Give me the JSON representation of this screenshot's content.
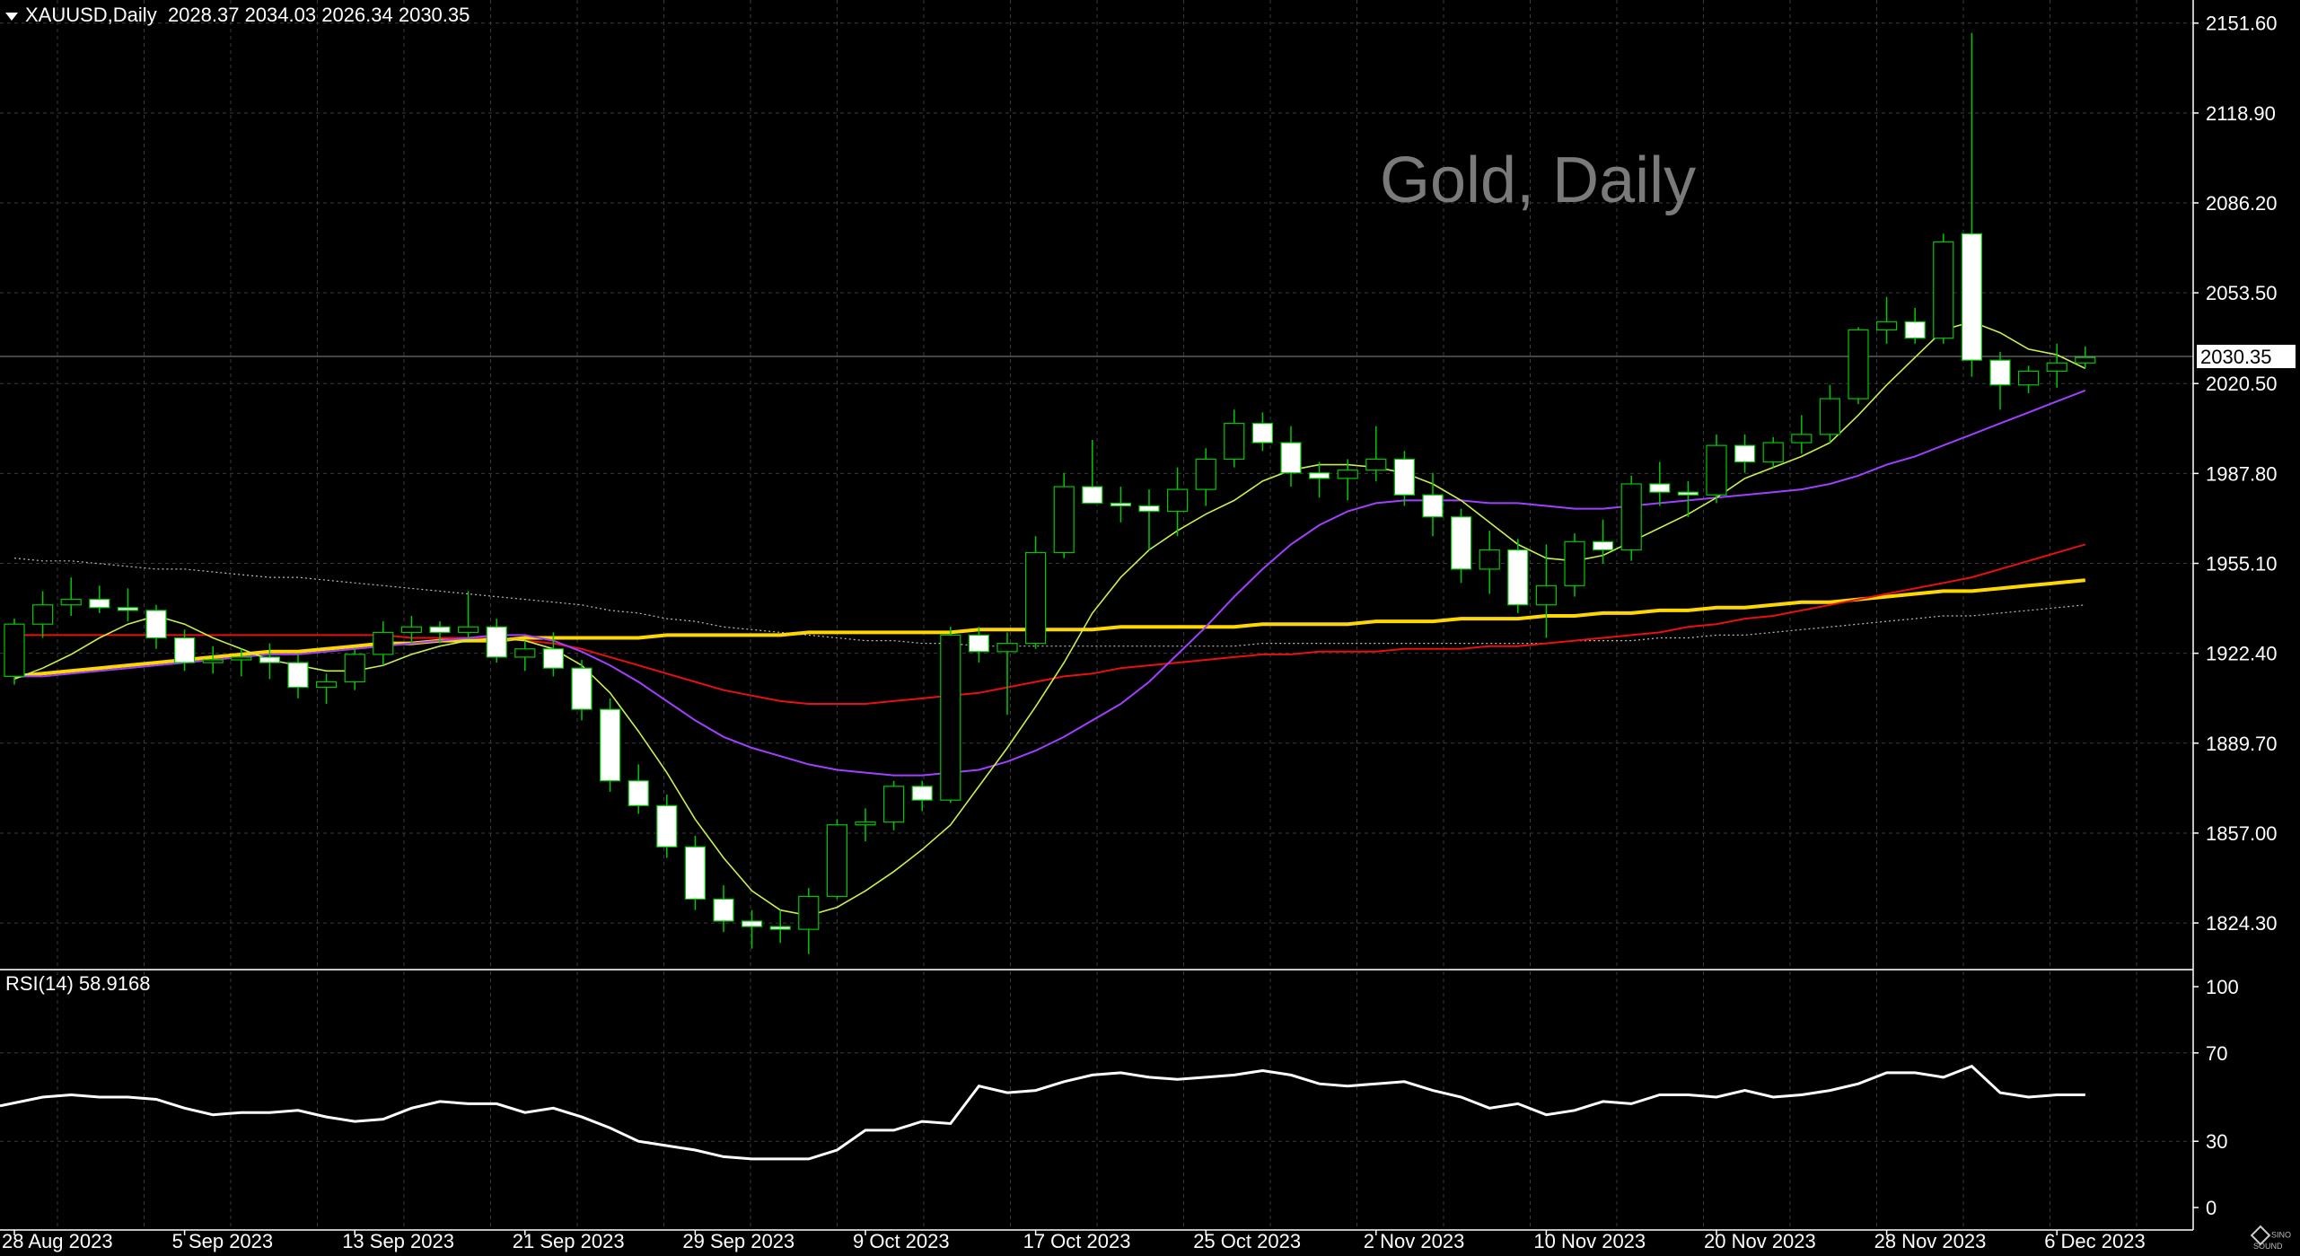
{
  "header": {
    "symbol": "XAUUSD,Daily",
    "ohlc": "2028.37 2034.03 2026.34 2030.35"
  },
  "watermark": "Gold, Daily",
  "rsi_label": "RSI(14) 58.9168",
  "logo_text": "SINO SOUND",
  "colors": {
    "background": "#000000",
    "grid": "#3a3a3a",
    "candle_up": "#000000",
    "candle_down": "#ffffff",
    "candle_outline": "#00c800",
    "ma_fast": "#c8f050",
    "ma_mid": "#a040ff",
    "ma_slow": "#e81010",
    "ma_long": "#ffd700",
    "ma_dotted": "#bbbbbb",
    "rsi": "#ffffff",
    "price_line": "#8a8a8a"
  },
  "chart_data": {
    "type": "candlestick",
    "price_axis": {
      "ylim": [
        1808,
        2160
      ],
      "ticks": [
        2151.6,
        2118.9,
        2086.2,
        2053.5,
        2020.5,
        1987.8,
        1955.1,
        1922.4,
        1889.7,
        1857.0,
        1824.3
      ],
      "tick_labels": [
        "2151.60",
        "2118.90",
        "2086.20",
        "2053.50",
        "2020.50",
        "1987.80",
        "1955.10",
        "1922.40",
        "1889.70",
        "1857.00",
        "1824.30"
      ],
      "current_price": 2030.35,
      "current_price_label": "2030.35"
    },
    "rsi_axis": {
      "ylim": [
        0,
        100
      ],
      "ticks": [
        100,
        70,
        30,
        0
      ],
      "tick_labels": [
        "100",
        "70",
        "30",
        "0"
      ]
    },
    "x_labels": [
      {
        "index": 0,
        "label": "28 Aug 2023"
      },
      {
        "index": 6,
        "label": "5 Sep 2023"
      },
      {
        "index": 12,
        "label": "13 Sep 2023"
      },
      {
        "index": 18,
        "label": "21 Sep 2023"
      },
      {
        "index": 24,
        "label": "29 Sep 2023"
      },
      {
        "index": 30,
        "label": "9 Oct 2023"
      },
      {
        "index": 36,
        "label": "17 Oct 2023"
      },
      {
        "index": 42,
        "label": "25 Oct 2023"
      },
      {
        "index": 48,
        "label": "2 Nov 2023"
      },
      {
        "index": 54,
        "label": "10 Nov 2023"
      },
      {
        "index": 60,
        "label": "20 Nov 2023"
      },
      {
        "index": 66,
        "label": "28 Nov 2023"
      },
      {
        "index": 72,
        "label": "6 Dec 2023"
      }
    ],
    "candles": [
      [
        1914,
        1935,
        1911,
        1933
      ],
      [
        1933,
        1945,
        1928,
        1940
      ],
      [
        1940,
        1950,
        1936,
        1942
      ],
      [
        1942,
        1947,
        1937,
        1939
      ],
      [
        1939,
        1946,
        1934,
        1938
      ],
      [
        1938,
        1940,
        1924,
        1928
      ],
      [
        1928,
        1931,
        1916,
        1919
      ],
      [
        1919,
        1925,
        1915,
        1920
      ],
      [
        1920,
        1924,
        1914,
        1921
      ],
      [
        1921,
        1926,
        1913,
        1919
      ],
      [
        1919,
        1922,
        1906,
        1910
      ],
      [
        1910,
        1915,
        1904,
        1912
      ],
      [
        1912,
        1924,
        1909,
        1922
      ],
      [
        1922,
        1934,
        1918,
        1930
      ],
      [
        1930,
        1936,
        1926,
        1932
      ],
      [
        1932,
        1934,
        1926,
        1930
      ],
      [
        1930,
        1945,
        1928,
        1932
      ],
      [
        1932,
        1935,
        1919,
        1921
      ],
      [
        1921,
        1927,
        1916,
        1924
      ],
      [
        1924,
        1930,
        1914,
        1917
      ],
      [
        1917,
        1920,
        1898,
        1902
      ],
      [
        1902,
        1906,
        1872,
        1876
      ],
      [
        1876,
        1882,
        1864,
        1867
      ],
      [
        1867,
        1871,
        1848,
        1852
      ],
      [
        1852,
        1856,
        1829,
        1833
      ],
      [
        1833,
        1838,
        1821,
        1825
      ],
      [
        1825,
        1829,
        1815,
        1823
      ],
      [
        1823,
        1829,
        1817,
        1822
      ],
      [
        1822,
        1837,
        1813,
        1834
      ],
      [
        1834,
        1862,
        1833,
        1860
      ],
      [
        1860,
        1866,
        1854,
        1861
      ],
      [
        1861,
        1876,
        1858,
        1874
      ],
      [
        1874,
        1876,
        1865,
        1869
      ],
      [
        1869,
        1932,
        1868,
        1929
      ],
      [
        1929,
        1932,
        1919,
        1923
      ],
      [
        1923,
        1930,
        1900,
        1926
      ],
      [
        1926,
        1965,
        1924,
        1959
      ],
      [
        1959,
        1988,
        1957,
        1983
      ],
      [
        1983,
        2000,
        1979,
        1977
      ],
      [
        1977,
        1983,
        1970,
        1976
      ],
      [
        1976,
        1982,
        1960,
        1974
      ],
      [
        1974,
        1990,
        1965,
        1982
      ],
      [
        1982,
        1997,
        1976,
        1993
      ],
      [
        1993,
        2011,
        1990,
        2006
      ],
      [
        2006,
        2010,
        1996,
        1999
      ],
      [
        1999,
        2005,
        1983,
        1988
      ],
      [
        1988,
        1992,
        1979,
        1986
      ],
      [
        1986,
        1993,
        1978,
        1989
      ],
      [
        1989,
        2005,
        1985,
        1993
      ],
      [
        1993,
        1996,
        1976,
        1980
      ],
      [
        1980,
        1988,
        1965,
        1972
      ],
      [
        1972,
        1975,
        1948,
        1953
      ],
      [
        1953,
        1967,
        1944,
        1960
      ],
      [
        1960,
        1964,
        1937,
        1940
      ],
      [
        1940,
        1962,
        1928,
        1947
      ],
      [
        1947,
        1966,
        1943,
        1963
      ],
      [
        1963,
        1971,
        1955,
        1960
      ],
      [
        1960,
        1987,
        1956,
        1984
      ],
      [
        1984,
        1992,
        1976,
        1981
      ],
      [
        1981,
        1985,
        1972,
        1980
      ],
      [
        1980,
        2002,
        1977,
        1998
      ],
      [
        1998,
        2002,
        1988,
        1992
      ],
      [
        1992,
        2001,
        1990,
        1999
      ],
      [
        1999,
        2009,
        1995,
        2002
      ],
      [
        2002,
        2020,
        1999,
        2015
      ],
      [
        2015,
        2041,
        2013,
        2040
      ],
      [
        2040,
        2052,
        2035,
        2043
      ],
      [
        2043,
        2048,
        2035,
        2037
      ],
      [
        2037,
        2075,
        2035,
        2072
      ],
      [
        2075,
        2148,
        2023,
        2029
      ],
      [
        2029,
        2032,
        2011,
        2020
      ],
      [
        2020,
        2027,
        2017,
        2025
      ],
      [
        2025,
        2035,
        2019,
        2028
      ],
      [
        2028,
        2034,
        2026,
        2030
      ]
    ],
    "ma_fast": [
      1913,
      1917,
      1922,
      1928,
      1933,
      1936,
      1933,
      1928,
      1924,
      1920,
      1918,
      1916,
      1916,
      1918,
      1922,
      1925,
      1927,
      1928,
      1927,
      1924,
      1918,
      1908,
      1894,
      1879,
      1862,
      1848,
      1836,
      1829,
      1827,
      1830,
      1836,
      1843,
      1851,
      1860,
      1874,
      1888,
      1903,
      1919,
      1937,
      1950,
      1960,
      1967,
      1973,
      1978,
      1985,
      1989,
      1991,
      1991,
      1990,
      1988,
      1984,
      1978,
      1970,
      1962,
      1957,
      1956,
      1958,
      1963,
      1968,
      1973,
      1979,
      1986,
      1990,
      1994,
      1999,
      2009,
      2020,
      2030,
      2040,
      2043,
      2039,
      2033,
      2031,
      2026
    ],
    "ma_mid": [
      1914,
      1914,
      1915,
      1916,
      1917,
      1918,
      1919,
      1920,
      1921,
      1922,
      1922,
      1923,
      1924,
      1925,
      1926,
      1927,
      1928,
      1929,
      1929,
      1927,
      1923,
      1918,
      1912,
      1905,
      1898,
      1892,
      1888,
      1885,
      1882,
      1880,
      1879,
      1878,
      1878,
      1879,
      1880,
      1883,
      1887,
      1892,
      1898,
      1904,
      1912,
      1922,
      1932,
      1943,
      1953,
      1962,
      1969,
      1974,
      1977,
      1978,
      1978,
      1978,
      1977,
      1977,
      1976,
      1975,
      1975,
      1976,
      1977,
      1978,
      1979,
      1980,
      1981,
      1982,
      1984,
      1987,
      1991,
      1994,
      1998,
      2002,
      2006,
      2010,
      2014,
      2018
    ],
    "ma_slow": [
      1929,
      1929,
      1929,
      1929,
      1929,
      1929,
      1929,
      1929,
      1929,
      1929,
      1929,
      1929,
      1929,
      1929,
      1928,
      1928,
      1928,
      1928,
      1927,
      1926,
      1924,
      1921,
      1918,
      1915,
      1912,
      1909,
      1907,
      1905,
      1904,
      1904,
      1904,
      1905,
      1906,
      1907,
      1908,
      1910,
      1912,
      1914,
      1915,
      1917,
      1918,
      1919,
      1920,
      1921,
      1922,
      1922,
      1923,
      1923,
      1923,
      1924,
      1924,
      1924,
      1925,
      1925,
      1926,
      1927,
      1928,
      1929,
      1930,
      1932,
      1933,
      1935,
      1936,
      1938,
      1940,
      1942,
      1944,
      1946,
      1948,
      1950,
      1953,
      1956,
      1959,
      1962
    ],
    "ma_long": [
      1914,
      1915,
      1916,
      1917,
      1918,
      1919,
      1920,
      1921,
      1922,
      1923,
      1923,
      1924,
      1925,
      1926,
      1926,
      1927,
      1927,
      1927,
      1928,
      1928,
      1928,
      1928,
      1928,
      1929,
      1929,
      1929,
      1929,
      1929,
      1930,
      1930,
      1930,
      1930,
      1930,
      1930,
      1931,
      1931,
      1931,
      1931,
      1931,
      1932,
      1932,
      1932,
      1932,
      1932,
      1933,
      1933,
      1933,
      1933,
      1934,
      1934,
      1934,
      1935,
      1935,
      1935,
      1936,
      1936,
      1937,
      1937,
      1938,
      1938,
      1939,
      1939,
      1940,
      1941,
      1941,
      1942,
      1943,
      1944,
      1945,
      1945,
      1946,
      1947,
      1948,
      1949
    ],
    "ma_dotted": [
      1957,
      1956,
      1956,
      1955,
      1954,
      1953,
      1953,
      1952,
      1951,
      1950,
      1950,
      1949,
      1948,
      1947,
      1946,
      1945,
      1944,
      1943,
      1942,
      1941,
      1940,
      1938,
      1937,
      1935,
      1934,
      1932,
      1931,
      1930,
      1929,
      1928,
      1927,
      1927,
      1926,
      1926,
      1925,
      1925,
      1925,
      1925,
      1925,
      1925,
      1925,
      1925,
      1925,
      1925,
      1926,
      1926,
      1926,
      1926,
      1926,
      1926,
      1926,
      1926,
      1926,
      1926,
      1926,
      1927,
      1927,
      1927,
      1928,
      1928,
      1929,
      1929,
      1930,
      1931,
      1932,
      1933,
      1934,
      1935,
      1936,
      1936,
      1937,
      1938,
      1939,
      1940
    ],
    "rsi": [
      46,
      50,
      51,
      50,
      50,
      49,
      45,
      42,
      43,
      43,
      44,
      41,
      39,
      40,
      45,
      48,
      47,
      47,
      43,
      45,
      41,
      36,
      30,
      28,
      26,
      23,
      22,
      22,
      22,
      26,
      35,
      35,
      39,
      38,
      55,
      52,
      53,
      57,
      60,
      61,
      59,
      58,
      59,
      60,
      62,
      60,
      56,
      55,
      56,
      57,
      53,
      50,
      45,
      47,
      42,
      44,
      48,
      47,
      51,
      51,
      50,
      53,
      50,
      51,
      53,
      56,
      61,
      61,
      59,
      64,
      52,
      50,
      51,
      51
    ]
  }
}
